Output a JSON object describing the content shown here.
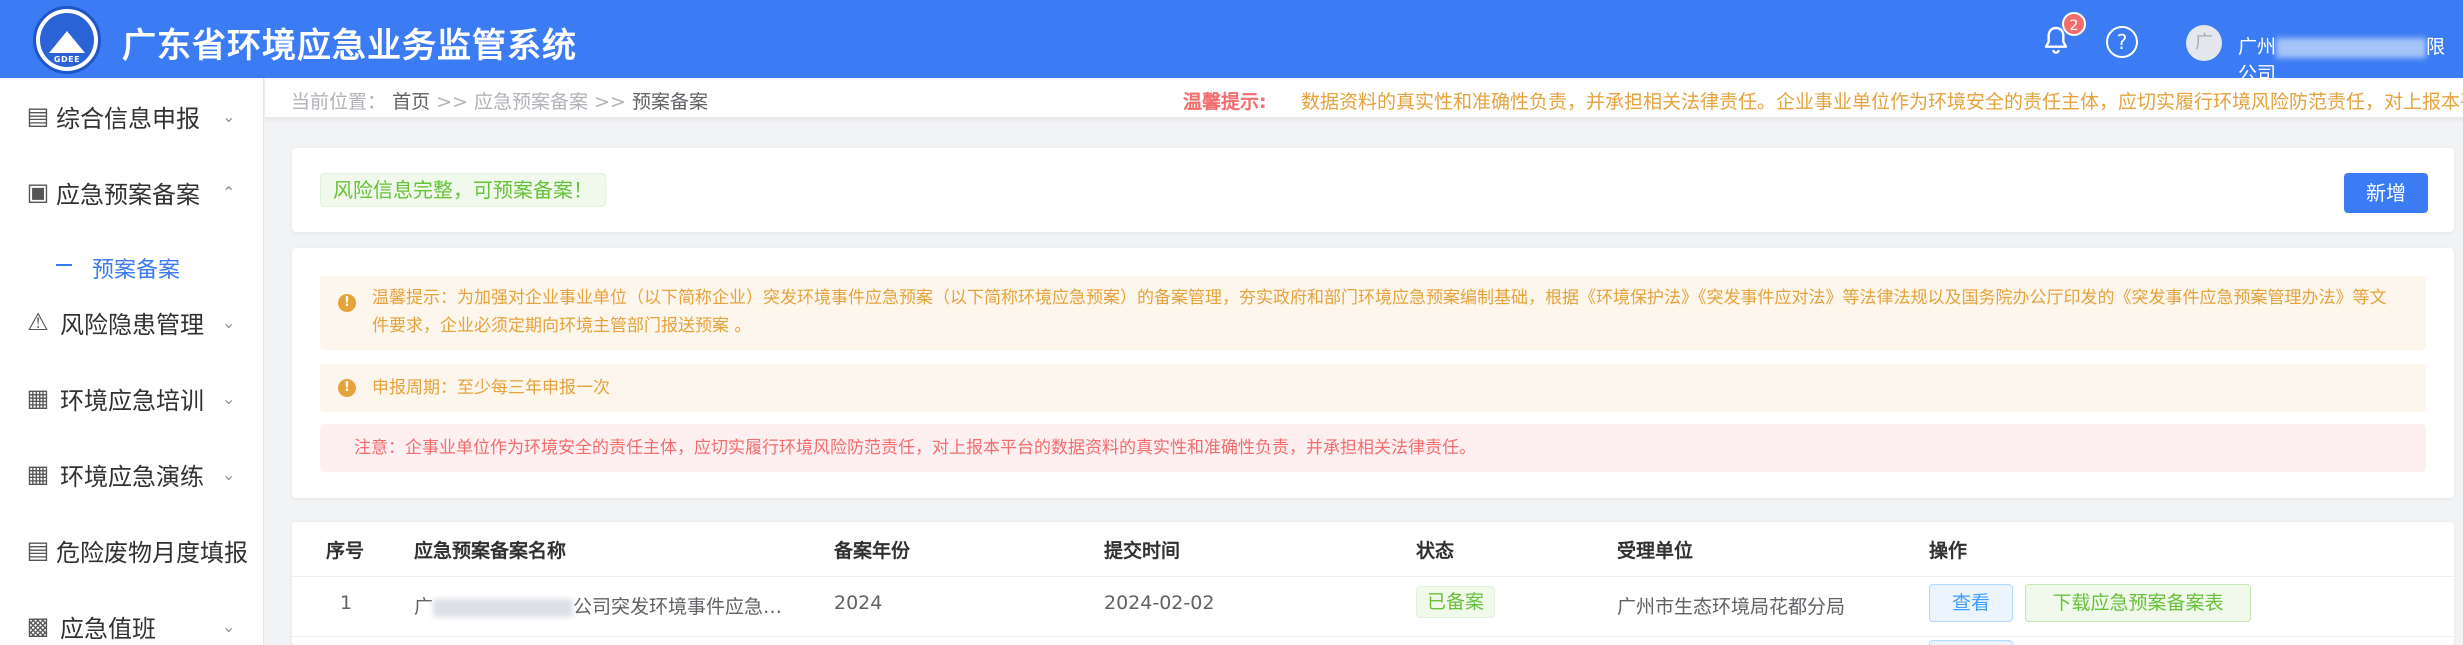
{
  "header": {
    "title": "广东省环境应急业务监管系统",
    "logo_text": "GDEE",
    "notification_count": "2",
    "help_glyph": "?",
    "avatar_letter": "广",
    "company_prefix": "广州",
    "company_suffix": "限公司",
    "icons": [
      "bell-icon",
      "help-icon"
    ]
  },
  "sidebar": {
    "items": [
      {
        "label": "综合信息申报",
        "icon": "document-icon"
      },
      {
        "label": "应急预案备案",
        "icon": "archive-icon"
      },
      {
        "label": "风险隐患管理",
        "icon": "warning-icon"
      },
      {
        "label": "环境应急培训",
        "icon": "grid-icon"
      },
      {
        "label": "环境应急演练",
        "icon": "grid-icon"
      },
      {
        "label": "危险废物月度填报",
        "icon": "document-icon"
      },
      {
        "label": "应急值班",
        "icon": "calendar-icon"
      }
    ],
    "sub_item": "预案备案"
  },
  "breadcrumb": {
    "prefix": "当前位置：",
    "home": "首页",
    "sep": ">>",
    "parent": "应急预案备案",
    "current": "预案备案"
  },
  "notice": {
    "label": "温馨提示:",
    "marquee": "数据资料的真实性和准确性负责，并承担相关法律责任。企业事业单位作为环境安全的责任主体，应切实履行环境风险防范责任，对上报本平"
  },
  "status_card": {
    "message": "风险信息完整，可预案备案！",
    "add_button": "新增"
  },
  "alerts": {
    "tip": "温馨提示：为加强对企业事业单位（以下简称企业）突发环境事件应急预案（以下简称环境应急预案）的备案管理，夯实政府和部门环境应急预案编制基础，根据《环境保护法》《突发事件应对法》等法律法规以及国务院办公厅印发的《突发事件应急预案管理办法》等文件要求，企业必须定期向环境主管部门报送预案 。",
    "period": "申报周期：至少每三年申报一次",
    "caution": "注意：企事业单位作为环境安全的责任主体，应切实履行环境风险防范责任，对上报本平台的数据资料的真实性和准确性负责，并承担相关法律责任。"
  },
  "table": {
    "columns": [
      "序号",
      "应急预案备案名称",
      "备案年份",
      "提交时间",
      "状态",
      "受理单位",
      "操作"
    ],
    "rows": [
      {
        "index": "1",
        "name_prefix": "广",
        "name_suffix": "公司突发环境事件应急…",
        "year": "2024",
        "submitted": "2024-02-02",
        "status": "已备案",
        "unit": "广州市生态环境局花都分局",
        "view": "查看",
        "download": "下载应急预案备案表"
      }
    ]
  }
}
